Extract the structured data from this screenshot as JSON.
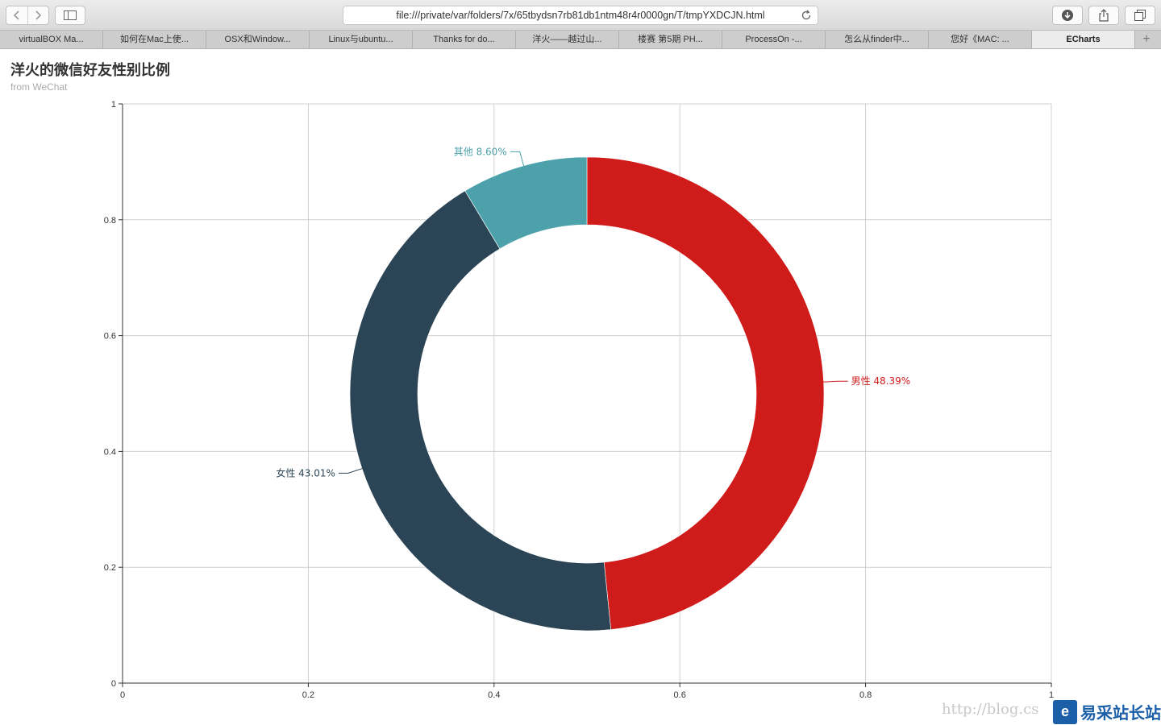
{
  "browser": {
    "url": "file:///private/var/folders/7x/65tbydsn7rb81db1ntm48r4r0000gn/T/tmpYXDCJN.html",
    "tabs": [
      {
        "label": "virtualBOX Ma...",
        "active": false
      },
      {
        "label": "如何在Mac上使...",
        "active": false
      },
      {
        "label": "OSX和Window...",
        "active": false
      },
      {
        "label": "Linux与ubuntu...",
        "active": false
      },
      {
        "label": "Thanks for do...",
        "active": false
      },
      {
        "label": "洋火——越过山...",
        "active": false
      },
      {
        "label": "楼赛 第5期 PH...",
        "active": false
      },
      {
        "label": "ProcessOn -...",
        "active": false
      },
      {
        "label": "怎么从finder中...",
        "active": false
      },
      {
        "label": "您好《MAC: ...",
        "active": false
      },
      {
        "label": "ECharts",
        "active": true
      }
    ]
  },
  "chart_data": {
    "type": "pie",
    "title": "洋火的微信好友性别比例",
    "subtitle": "from WeChat",
    "donut": true,
    "slices": [
      {
        "name": "男性",
        "value": 48.39,
        "label": "男性 48.39%",
        "color": "#d01b1b"
      },
      {
        "name": "女性",
        "value": 43.01,
        "label": "女性 43.01%",
        "color": "#2c4556"
      },
      {
        "name": "其他",
        "value": 8.6,
        "label": "其他 8.60%",
        "color": "#4da1ab"
      }
    ],
    "x_ticks": [
      "0",
      "0.2",
      "0.4",
      "0.6",
      "0.8",
      "1"
    ],
    "y_ticks": [
      "0",
      "0.2",
      "0.4",
      "0.6",
      "0.8",
      "1"
    ],
    "xlim": [
      0,
      1
    ],
    "ylim": [
      0,
      1
    ],
    "grid": true
  },
  "watermark": {
    "text": "http://blog.cs",
    "brand": "易采站长站"
  }
}
